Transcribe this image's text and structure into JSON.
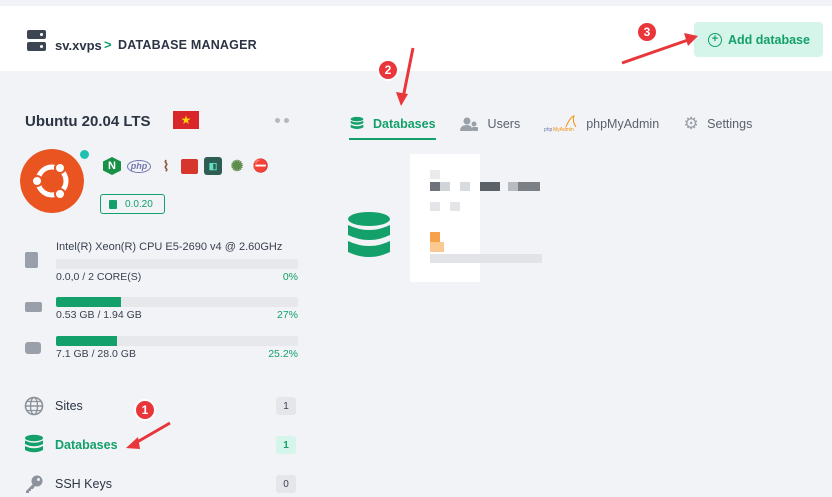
{
  "breadcrumb": {
    "server_name": "sv.xvps",
    "separator": ">",
    "page_title": "DATABASE MANAGER"
  },
  "header": {
    "add_button_label": "Add database"
  },
  "server": {
    "os_title": "Ubuntu 20.04 LTS",
    "flag_icon": "vietnam-flag-icon",
    "version": "0.0.20",
    "installed_apps": [
      "nginx-icon",
      "php-icon",
      "mariadb-icon",
      "redis-icon",
      "terminal-icon",
      "octopus-icon",
      "security-icon"
    ],
    "cpu": {
      "name": "Intel(R) Xeon(R) CPU E5-2690 v4 @ 2.60GHz",
      "usage": "0.0,0 / 2 CORE(S)",
      "percent": "0%",
      "fraction": 0
    },
    "ram": {
      "usage": "0.53 GB / 1.94 GB",
      "percent": "27%",
      "fraction": 0.27
    },
    "disk": {
      "usage": "7.1 GB / 28.0 GB",
      "percent": "25.2%",
      "fraction": 0.252
    }
  },
  "sidebar": {
    "items": [
      {
        "label": "Sites",
        "count": "1",
        "icon": "globe-icon"
      },
      {
        "label": "Databases",
        "count": "1",
        "icon": "database-icon",
        "active": true
      },
      {
        "label": "SSH Keys",
        "count": "0",
        "icon": "key-icon"
      }
    ]
  },
  "tabs": [
    {
      "label": "Databases",
      "icon": "database-icon",
      "active": true
    },
    {
      "label": "Users",
      "icon": "users-icon"
    },
    {
      "label": "phpMyAdmin",
      "icon": "phpmyadmin-icon"
    },
    {
      "label": "Settings",
      "icon": "gear-icon"
    }
  ],
  "annotations": [
    {
      "number": "1"
    },
    {
      "number": "2"
    },
    {
      "number": "3"
    }
  ],
  "colors": {
    "accent": "#13a06a",
    "accent_light": "#d6f5ea",
    "ubuntu": "#e95420",
    "annotation": "#e8363a"
  }
}
